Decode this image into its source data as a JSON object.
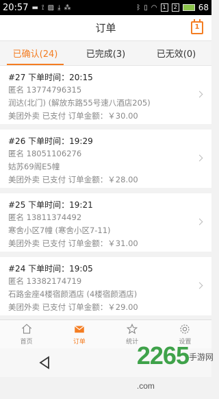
{
  "status": {
    "time": "20:57",
    "battery": "68",
    "sim1": "1",
    "sim2": "2"
  },
  "header": {
    "title": "订单",
    "calendar_day": "1"
  },
  "tabs": [
    {
      "label": "已确认(24)",
      "active": true
    },
    {
      "label": "已完成(3)",
      "active": false
    },
    {
      "label": "已无效(0)",
      "active": false
    }
  ],
  "orders": [
    {
      "title": "#27 下单时间：20:15",
      "phone": "匿名 13774796315",
      "address": "润达(北门) (解放东路55号速八酒店205)",
      "summary": "美团外卖 已支付 订单金额：￥30.00"
    },
    {
      "title": "#26 下单时间：19:29",
      "phone": "匿名 18051106276",
      "address": "姑苏69阁E5幢",
      "summary": "美团外卖 已支付 订单金额：￥28.00"
    },
    {
      "title": "#25 下单时间：19:21",
      "phone": "匿名 13811374492",
      "address": "寒舍小区7幢 (寒舍小区7-11)",
      "summary": "美团外卖 已支付 订单金额：￥31.00"
    },
    {
      "title": "#24 下单时间：19:05",
      "phone": "匿名 13382174719",
      "address": "石路金座4楼宿颜酒店 (4楼宿颜酒店)",
      "summary": "美团外卖 已支付 订单金额：￥29.00"
    }
  ],
  "nav": [
    {
      "label": "首页",
      "icon": "home-icon",
      "active": false
    },
    {
      "label": "订单",
      "icon": "mail-icon",
      "active": true
    },
    {
      "label": "统计",
      "icon": "star-icon",
      "active": false
    },
    {
      "label": "设置",
      "icon": "gear-icon",
      "active": false
    }
  ],
  "watermark": {
    "number": "2265",
    "suffix": "手游网",
    "domain": ".com"
  },
  "colors": {
    "accent": "#f47d22"
  }
}
